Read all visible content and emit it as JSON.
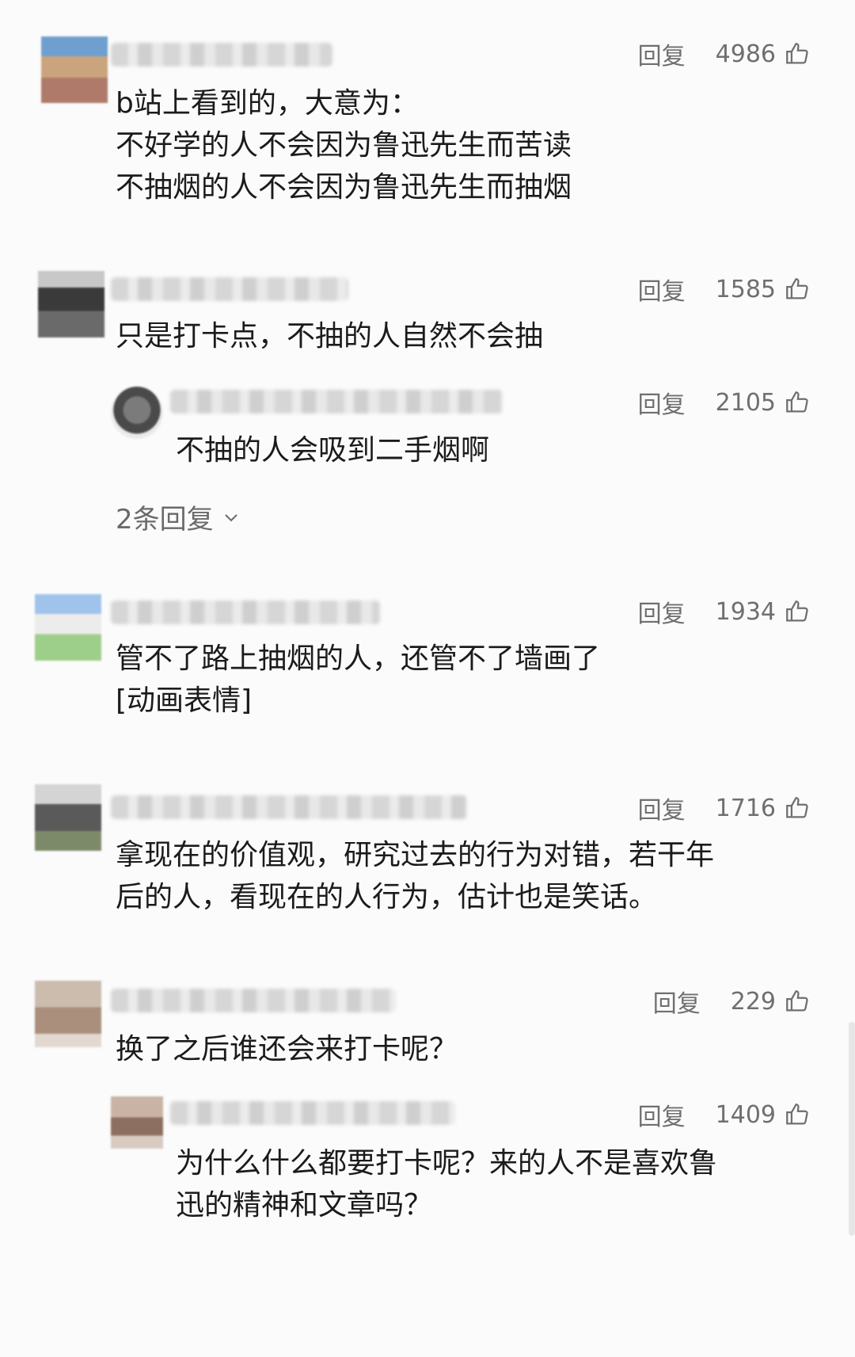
{
  "reply_label": "回复",
  "comments": [
    {
      "likes": "4986",
      "text": "b站上看到的，大意为：\n不好学的人不会因为鲁迅先生而苦读\n不抽烟的人不会因为鲁迅先生而抽烟"
    },
    {
      "likes": "1585",
      "text": "只是打卡点，不抽的人自然不会抽"
    },
    {
      "likes": "2105",
      "text": "不抽的人会吸到二手烟啊"
    },
    {
      "likes": "1934",
      "text": "管不了路上抽烟的人，还管不了墙画了\n[动画表情]"
    },
    {
      "likes": "1716",
      "text": "拿现在的价值观，研究过去的行为对错，若干年\n后的人，看现在的人行为，估计也是笑话。"
    },
    {
      "likes": "229",
      "text": "换了之后谁还会来打卡呢？"
    },
    {
      "likes": "1409",
      "text": "为什么什么都要打卡呢？来的人不是喜欢鲁\n迅的精神和文章吗？"
    }
  ],
  "more_replies": "2条回复",
  "icons": {
    "like": "thumbs-up-icon",
    "expand": "chevron-down-icon"
  }
}
